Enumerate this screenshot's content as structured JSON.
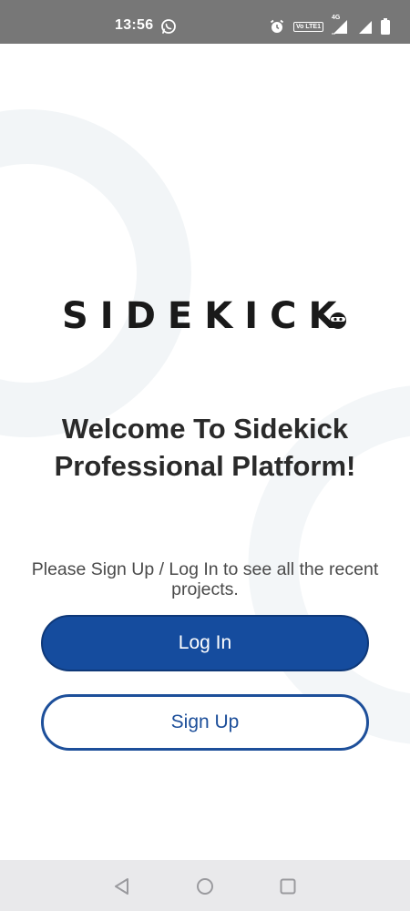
{
  "status_bar": {
    "time": "13:56",
    "lte_badge": "Vo LTE1",
    "net_tag": "4G",
    "left_icon": "whatsapp-icon",
    "right_icons": [
      "alarm-icon",
      "volte-icon",
      "signal-icon",
      "battery-icon"
    ]
  },
  "logo": {
    "text": "SIDEKICK",
    "badge_icon": "mascot-face-icon"
  },
  "welcome": {
    "line1": "Welcome To Sidekick",
    "line2": "Professional Platform!"
  },
  "subtitle": "Please Sign Up / Log In to see all the recent projects.",
  "buttons": {
    "login_label": "Log In",
    "signup_label": "Sign Up"
  },
  "nav": {
    "back_icon": "back-triangle-icon",
    "home_icon": "home-circle-icon",
    "recents_icon": "recents-square-icon"
  },
  "colors": {
    "primary": "#154c9e",
    "primary_border": "#1d4f9a",
    "status_bar": "#777777",
    "nav_bar": "#e9e9eb"
  }
}
